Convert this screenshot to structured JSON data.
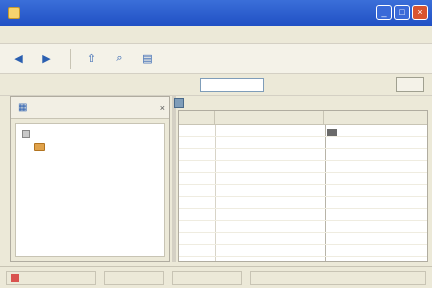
{
  "window": {
    "title": "",
    "controls": {
      "minimize": "_",
      "maximize": "□",
      "close": "×"
    }
  },
  "menubar": {
    "items": [
      "",
      "",
      "",
      "",
      "",
      "",
      ""
    ]
  },
  "toolbar": {
    "back_label": "",
    "forward_label": "",
    "up_label": "",
    "search_label": "",
    "folders_label": ""
  },
  "addressbar": {
    "label": "",
    "value": "",
    "go_label": ""
  },
  "left_pane": {
    "header_label": "",
    "close_glyph": "×",
    "tree": {
      "root_label": "",
      "child_label": ""
    }
  },
  "list": {
    "columns": [
      "",
      "",
      ""
    ],
    "rows": [
      [
        "",
        "",
        ""
      ],
      [
        "",
        "",
        ""
      ],
      [
        "",
        "",
        ""
      ],
      [
        "",
        "",
        ""
      ],
      [
        "",
        "",
        ""
      ],
      [
        "",
        "",
        ""
      ],
      [
        "",
        "",
        ""
      ],
      [
        "",
        "",
        ""
      ],
      [
        "",
        "",
        ""
      ],
      [
        "",
        "",
        ""
      ],
      [
        "",
        "",
        ""
      ]
    ]
  },
  "statusbar": {
    "panels": [
      "",
      "",
      "",
      ""
    ]
  },
  "colors": {
    "titlebar": "#2150c4",
    "chrome": "#ece9d8",
    "accent": "#2b5fb0",
    "folder": "#e0a24a",
    "close": "#d8542f"
  },
  "icons": {
    "app": "app-icon",
    "back": "back-arrow-icon",
    "forward": "forward-arrow-icon",
    "up": "folder-up-icon",
    "search": "search-icon",
    "folders": "folders-icon",
    "drive": "drive-icon",
    "folder": "folder-icon"
  }
}
